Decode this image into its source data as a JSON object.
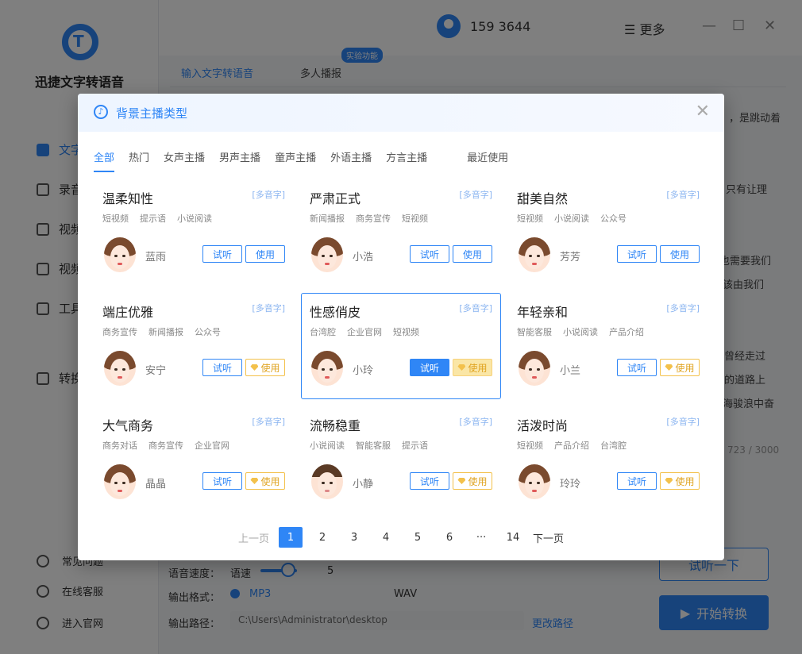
{
  "app": {
    "name": "迅捷文字转语音",
    "phone": "159   3644",
    "more": "更多",
    "sidebar": [
      "文字",
      "录音",
      "视频",
      "视频",
      "工具",
      "转换"
    ],
    "bottom_links": [
      "常见问题",
      "在线客服",
      "进入官网"
    ]
  },
  "main": {
    "tabs": [
      "输入文字转语音",
      "多人播报"
    ],
    "exp_badge": "实验功能",
    "snippets": [
      "，是跳动着",
      "只有让理",
      "也需要我们",
      "该由我们",
      "曾经走过",
      "的道路上",
      "海骏浪中奋"
    ],
    "counter": "723 / 3000",
    "speed_label": "语音速度：",
    "speed_sub": "语速",
    "speed_value": "5",
    "format_label": "输出格式：",
    "format_mp3": "MP3",
    "format_wav": "WAV",
    "path_label": "输出路径：",
    "path_value": "C:\\Users\\Administrator\\desktop",
    "change_path": "更改路径",
    "try_button": "试听一下",
    "start_button": "开始转换"
  },
  "modal": {
    "title": "背景主播类型",
    "categories": [
      "全部",
      "热门",
      "女声主播",
      "男声主播",
      "童声主播",
      "外语主播",
      "方言主播",
      "最近使用"
    ],
    "poly_label": "[多音字]",
    "listen_label": "试听",
    "use_label": "使用",
    "voices": [
      {
        "title": "温柔知性",
        "tags": [
          "短视频",
          "提示语",
          "小说阅读"
        ],
        "name": "蓝雨"
      },
      {
        "title": "严肃正式",
        "tags": [
          "新闻播报",
          "商务宣传",
          "短视频"
        ],
        "name": "小浩"
      },
      {
        "title": "甜美自然",
        "tags": [
          "短视频",
          "小说阅读",
          "公众号"
        ],
        "name": "芳芳"
      },
      {
        "title": "端庄优雅",
        "tags": [
          "商务宣传",
          "新闻播报",
          "公众号"
        ],
        "name": "安宁"
      },
      {
        "title": "性感俏皮",
        "tags": [
          "台湾腔",
          "企业官网",
          "短视频"
        ],
        "name": "小玲"
      },
      {
        "title": "年轻亲和",
        "tags": [
          "智能客服",
          "小说阅读",
          "产品介绍"
        ],
        "name": "小兰"
      },
      {
        "title": "大气商务",
        "tags": [
          "商务对话",
          "商务宣传",
          "企业官网"
        ],
        "name": "晶晶"
      },
      {
        "title": "流畅稳重",
        "tags": [
          "小说阅读",
          "智能客服",
          "提示语"
        ],
        "name": "小静"
      },
      {
        "title": "活泼时尚",
        "tags": [
          "短视频",
          "产品介绍",
          "台湾腔"
        ],
        "name": "玲玲"
      }
    ],
    "pager": {
      "prev": "上一页",
      "pages": [
        "1",
        "2",
        "3",
        "4",
        "5",
        "6",
        "···",
        "14"
      ],
      "next": "下一页"
    }
  }
}
